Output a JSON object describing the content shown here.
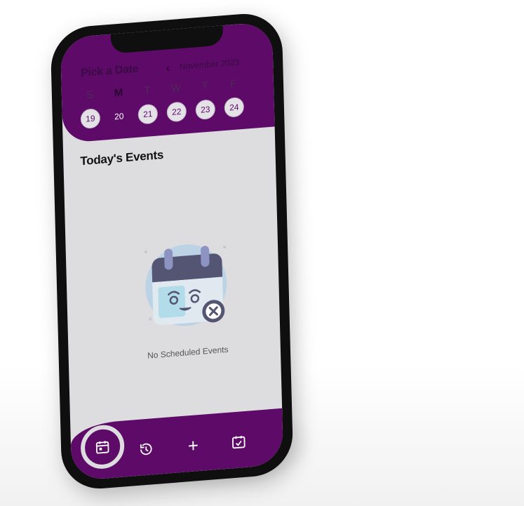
{
  "header": {
    "title": "Pick a Date",
    "month": "November 2023",
    "weekdays": [
      "S",
      "M",
      "T",
      "W",
      "T",
      "F"
    ],
    "dates": [
      "19",
      "20",
      "21",
      "22",
      "23",
      "24"
    ]
  },
  "main": {
    "section_title": "Today's Events",
    "empty_message": "No Scheduled Events"
  },
  "nav": {
    "plus_glyph": "+"
  },
  "colors": {
    "primary": "#5d0a68",
    "screen_bg": "#dddcdf"
  }
}
